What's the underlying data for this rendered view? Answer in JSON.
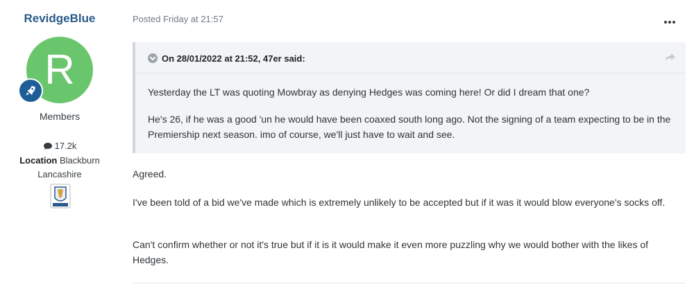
{
  "author": {
    "name": "RevidgeBlue",
    "avatar_letter": "R",
    "avatar_color": "#6ac66d",
    "group": "Members",
    "post_count": "17.2k",
    "location_label": "Location",
    "location_value": "Blackburn Lancashire"
  },
  "post": {
    "meta": "Posted Friday at 21:57",
    "menu_icon": "ellipsis-icon",
    "quote": {
      "header": "On 28/01/2022 at 21:52, 47er said:",
      "paragraphs": [
        "Yesterday the LT was quoting Mowbray as denying Hedges was coming here! Or did I dream that one?",
        "He's 26, if he was a good 'un he would have been coaxed south long ago. Not the signing of a team expecting to be in the Premiership next season. imo of course, we'll just have to wait and see."
      ]
    },
    "paragraphs": [
      "Agreed.",
      "I've been told of a bid we've made which is extremely unlikely to be accepted but if it was it would blow everyone's socks off.",
      "Can't confirm whether or not it's true but if it is it would make it even more puzzling why we would bother with the likes of Hedges."
    ]
  }
}
